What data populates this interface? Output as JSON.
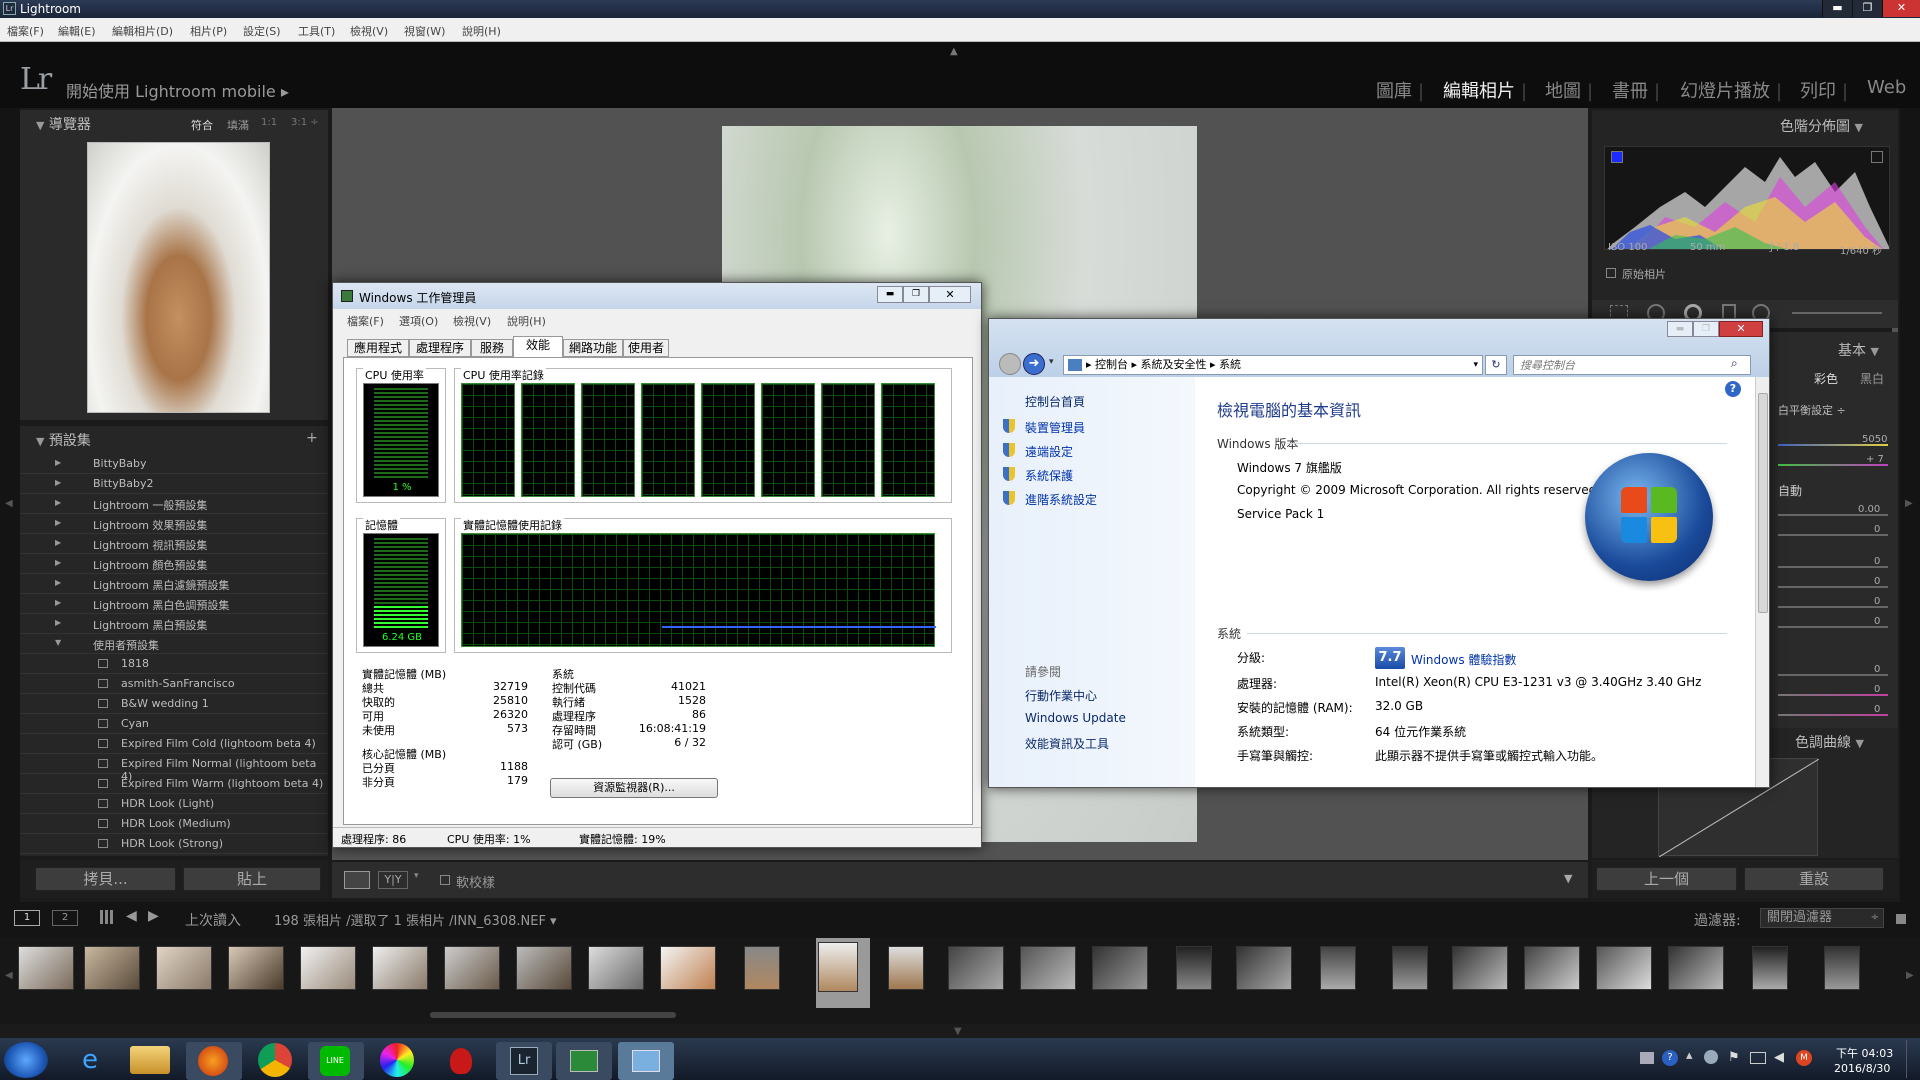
{
  "window": {
    "title": "Lightroom",
    "min": "▬",
    "max": "❐",
    "close": "✕"
  },
  "menu": [
    "檔案(F)",
    "編輯(E)",
    "編輯相片(D)",
    "相片(P)",
    "設定(S)",
    "工具(T)",
    "檢視(V)",
    "視窗(W)",
    "說明(H)"
  ],
  "topbar": {
    "logo": "Lr",
    "mobile": "開始使用 Lightroom mobile",
    "modules": [
      "圖庫",
      "編輯相片",
      "地圖",
      "書冊",
      "幻燈片播放",
      "列印",
      "Web"
    ],
    "active": "編輯相片"
  },
  "navigator": {
    "title": "導覽器",
    "zoom": [
      "符合",
      "填滿",
      "1:1",
      "3:1"
    ]
  },
  "presets": {
    "title": "預設集",
    "add": "+",
    "groups": [
      "BittyBaby",
      "BittyBaby2",
      "Lightroom 一般預設集",
      "Lightroom 效果預設集",
      "Lightroom 視訊預設集",
      "Lightroom 顏色預設集",
      "Lightroom 黑白濾鏡預設集",
      "Lightroom 黑白色調預設集",
      "Lightroom 黑白預設集",
      "使用者預設集"
    ],
    "user": [
      "1818",
      "asmith-SanFrancisco",
      "B&W wedding 1",
      "Cyan",
      "Expired Film Cold (lightoom beta 4)",
      "Expired Film Normal (lightoom beta 4)",
      "Expired Film Warm (lightoom beta 4)",
      "HDR Look (Light)",
      "HDR Look (Medium)",
      "HDR Look (Strong)"
    ]
  },
  "leftbuttons": {
    "copy": "拷貝...",
    "paste": "貼上"
  },
  "toolbar": {
    "proof": "軟校樣",
    "yy": "Y|Y"
  },
  "histogram": {
    "title": "色階分佈圖",
    "iso": "ISO 100",
    "focal": "50 mm",
    "aperture": "ƒ / 1.8",
    "shutter": "1/640 秒",
    "original": "原始相片"
  },
  "basic": {
    "title": "基本",
    "color": "彩色",
    "bw": "黑白",
    "wb": "白平衡設定 ÷",
    "temp": "5050",
    "tint": "+ 7",
    "auto": "自動",
    "exposure": "0.00",
    "vals": [
      "0",
      "0",
      "0",
      "0",
      "0",
      "0",
      "0",
      "0"
    ]
  },
  "tonecurve": {
    "title": "色調曲線"
  },
  "rightbuttons": {
    "prev": "上一個",
    "reset": "重設"
  },
  "filmstrip": {
    "page1": "1",
    "page2": "2",
    "source": "上次讀入",
    "info": "198 張相片 /選取了 1 張相片 /INN_6308.NEF ▾",
    "filter_label": "過濾器:",
    "filter_value": "關閉過濾器"
  },
  "taskmgr": {
    "title": "Windows 工作管理員",
    "menu": [
      "檔案(F)",
      "選項(O)",
      "檢視(V)",
      "說明(H)"
    ],
    "tabs": [
      "應用程式",
      "處理程序",
      "服務",
      "效能",
      "網路功能",
      "使用者"
    ],
    "active_tab": "效能",
    "cpu_label": "CPU 使用率",
    "cpu_value": "1 %",
    "cpu_history": "CPU 使用率記錄",
    "mem_label": "記憶體",
    "mem_value": "6.24 GB",
    "mem_history": "實體記憶體使用記錄",
    "mem_percent": 19,
    "phys": {
      "title": "實體記憶體 (MB)",
      "rows": [
        [
          "總共",
          "32719"
        ],
        [
          "快取的",
          "25810"
        ],
        [
          "可用",
          "26320"
        ],
        [
          "未使用",
          "573"
        ]
      ]
    },
    "kernel": {
      "title": "核心記憶體 (MB)",
      "rows": [
        [
          "已分頁",
          "1188"
        ],
        [
          "非分頁",
          "179"
        ]
      ]
    },
    "system": {
      "title": "系統",
      "rows": [
        [
          "控制代碼",
          "41021"
        ],
        [
          "執行緒",
          "1528"
        ],
        [
          "處理程序",
          "86"
        ],
        [
          "存留時間",
          "16:08:41:19"
        ],
        [
          "認可 (GB)",
          "6 / 32"
        ]
      ]
    },
    "resmon": "資源監視器(R)...",
    "status": {
      "proc": "處理程序: 86",
      "cpu": "CPU 使用率: 1%",
      "mem": "實體記憶體: 19%"
    }
  },
  "controlpanel": {
    "breadcrumb": [
      "控制台",
      "系統及安全性",
      "系統"
    ],
    "search_placeholder": "搜尋控制台",
    "nav_home": "控制台首頁",
    "nav": [
      "裝置管理員",
      "遠端設定",
      "系統保護",
      "進階系統設定"
    ],
    "see_also": "請參閱",
    "see": [
      "行動作業中心",
      "Windows Update",
      "效能資訊及工具"
    ],
    "heading": "檢視電腦的基本資訊",
    "edition_title": "Windows 版本",
    "edition": "Windows 7 旗艦版",
    "copyright": "Copyright © 2009 Microsoft Corporation.  All rights reserved.",
    "sp": "Service Pack 1",
    "system_title": "系統",
    "rating_label": "分級:",
    "rating_score": "7.7",
    "rating_link": "Windows 體驗指數",
    "rows": [
      [
        "處理器:",
        "Intel(R) Xeon(R) CPU E3-1231 v3 @ 3.40GHz   3.40 GHz"
      ],
      [
        "安裝的記憶體 (RAM):",
        "32.0 GB"
      ],
      [
        "系統類型:",
        "64 位元作業系統"
      ],
      [
        "手寫筆與觸控:",
        "此顯示器不提供手寫筆或觸控式輸入功能。"
      ]
    ]
  },
  "taskbar": {
    "time": "下午 04:03",
    "date": "2016/8/30"
  }
}
